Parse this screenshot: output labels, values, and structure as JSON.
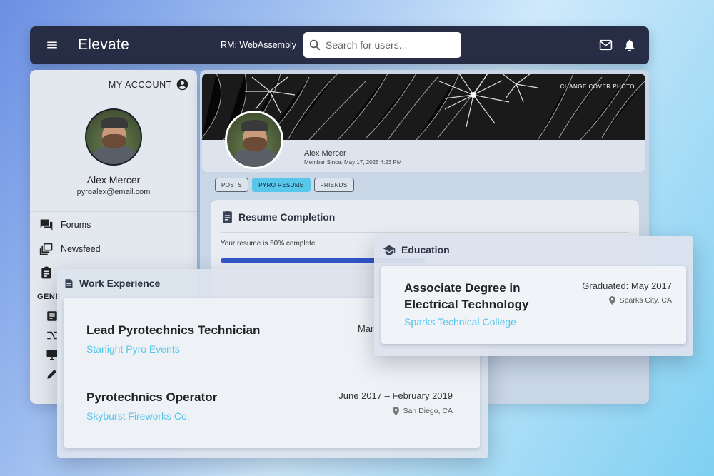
{
  "header": {
    "brand": "Elevate",
    "room": "RM: WebAssembly",
    "search_placeholder": "Search for users..."
  },
  "sidebar": {
    "account_label": "MY ACCOUNT",
    "user_name": "Alex Mercer",
    "user_email": "pyroalex@email.com",
    "items": [
      {
        "label": "Forums",
        "icon": "forum-icon"
      },
      {
        "label": "Newsfeed",
        "icon": "newsfeed-icon"
      },
      {
        "label": "",
        "icon": "resume-icon"
      }
    ],
    "section_label": "GENE"
  },
  "profile": {
    "change_cover": "CHANGE COVER PHOTO",
    "name": "Alex Mercer",
    "member_since": "Member Since: May 17, 2025 4:23 PM"
  },
  "tabs": [
    {
      "label": "POSTS",
      "active": false
    },
    {
      "label": "PYRO RESUME",
      "active": true
    },
    {
      "label": "FRIENDS",
      "active": false
    }
  ],
  "resume": {
    "title": "Resume Completion",
    "text": "Your resume is 50% complete.",
    "progress": 0.5
  },
  "work": {
    "title": "Work Experience",
    "jobs": [
      {
        "title": "Lead Pyrotechnics Technician",
        "company": "Starlight Pyro Events",
        "dates": "Mar",
        "location": ""
      },
      {
        "title": "Pyrotechnics Operator",
        "company": "Skyburst Fireworks Co.",
        "dates": "June 2017 – February 2019",
        "location": "San Diego, CA"
      }
    ]
  },
  "education": {
    "title": "Education",
    "degree": "Associate Degree in Electrical Technology",
    "school": "Sparks Technical College",
    "graduated": "Graduated: May 2017",
    "location": "Sparks City, CA"
  },
  "colors": {
    "topbar": "#262d45",
    "accent_cyan": "#58c7ec",
    "progress_blue": "#3355c9"
  }
}
